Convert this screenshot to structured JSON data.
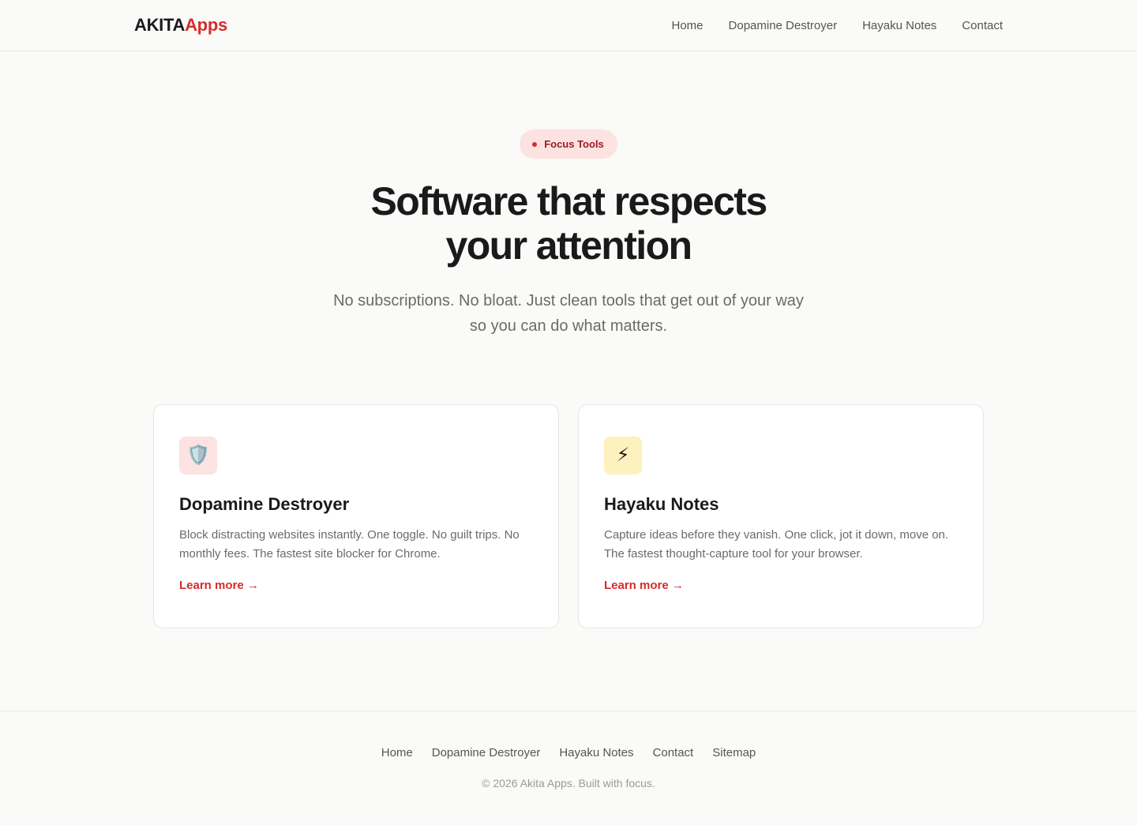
{
  "brand": {
    "logo_part1": "AKITA",
    "logo_part2": "Apps",
    "accent_color": "#d62b2b"
  },
  "header": {
    "nav": [
      {
        "label": "Home"
      },
      {
        "label": "Dopamine Destroyer"
      },
      {
        "label": "Hayaku Notes"
      },
      {
        "label": "Contact"
      }
    ]
  },
  "hero": {
    "badge_label": "Focus Tools",
    "title_line1": "Software that respects",
    "title_line2": "your attention",
    "subtitle": "No subscriptions. No bloat. Just clean tools that get out of your way so you can do what matters."
  },
  "products": [
    {
      "icon": "shield-icon",
      "icon_glyph": "🛡️",
      "title": "Dopamine Destroyer",
      "description": "Block distracting websites instantly. One toggle. No guilt trips. No monthly fees. The fastest site blocker for Chrome.",
      "link_label": "Learn more →"
    },
    {
      "icon": "lightning-icon",
      "icon_glyph": "⚡",
      "title": "Hayaku Notes",
      "description": "Capture ideas before they vanish. One click, jot it down, move on. The fastest thought-capture tool for your browser.",
      "link_label": "Learn more →"
    }
  ],
  "footer": {
    "nav": [
      {
        "label": "Home"
      },
      {
        "label": "Dopamine Destroyer"
      },
      {
        "label": "Hayaku Notes"
      },
      {
        "label": "Contact"
      },
      {
        "label": "Sitemap"
      }
    ],
    "copyright": "© 2026 Akita Apps. Built with focus."
  }
}
